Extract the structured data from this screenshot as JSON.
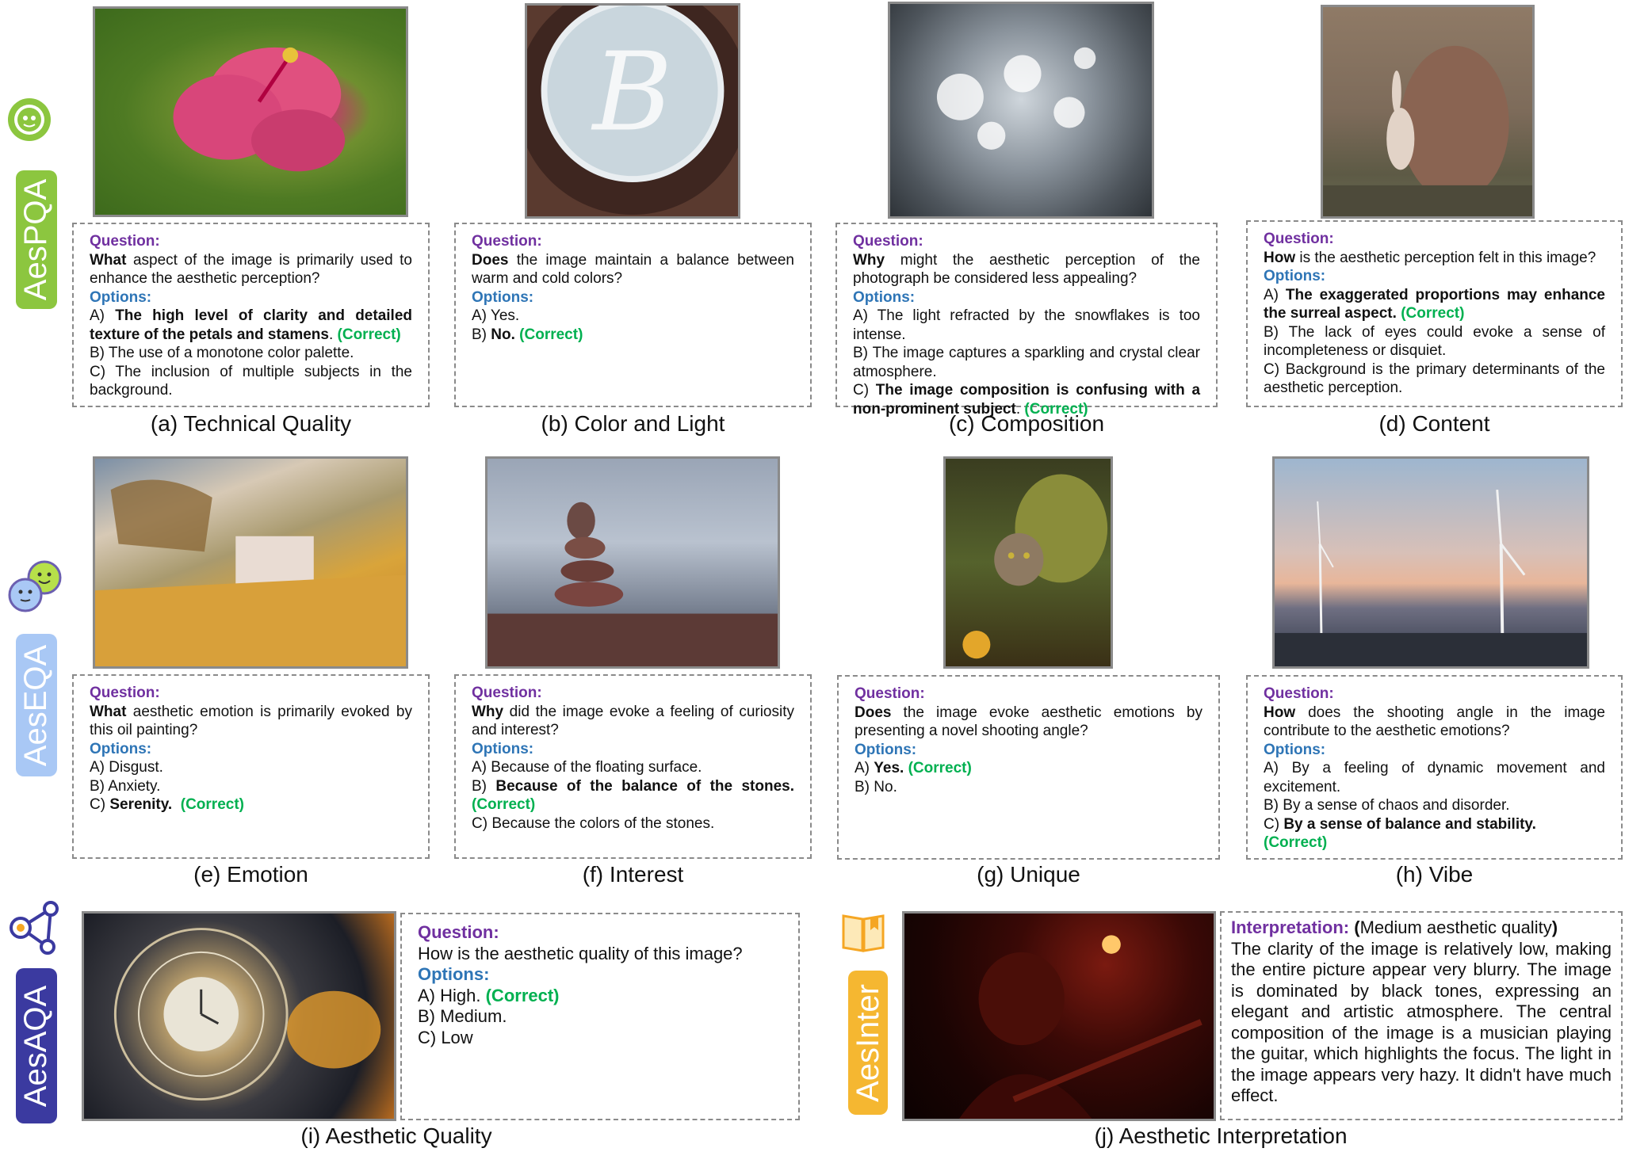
{
  "sections": {
    "aespqa": "AesPQA",
    "aeseqa": "AesEQA",
    "aesaqa": "AesAQA",
    "aesinter": "AesInter"
  },
  "labels": {
    "question": "Question:",
    "options": "Options:",
    "correct": "(Correct)",
    "interpretation": "Interpretation:"
  },
  "panels": {
    "a": {
      "caption": "(a) Technical Quality",
      "q_bold": "What",
      "q_rest": " aspect of the image is primarily used to enhance the aesthetic perception?",
      "opt_a_prefix": "A) ",
      "opt_a_bold": "The high level of clarity and detailed texture of the petals and stamens",
      "opt_a_tail": ". ",
      "opt_b": "B) The use of a monotone color palette.",
      "opt_c": "C) The inclusion of multiple subjects in the background."
    },
    "b": {
      "caption": "(b) Color and Light",
      "q_bold": "Does",
      "q_rest": " the image maintain a balance between warm and cold colors?",
      "opt_a": "A) Yes.",
      "opt_b_prefix": "B) ",
      "opt_b_bold": "No."
    },
    "c": {
      "caption": "(c) Composition",
      "q_bold": "Why",
      "q_rest": " might the aesthetic perception of the photograph be considered less appealing?",
      "opt_a": "A) The light refracted by the snowflakes is too intense.",
      "opt_b": "B) The image captures a sparkling and crystal clear atmosphere.",
      "opt_c_prefix": "C) ",
      "opt_c_bold": "The image composition is confusing with a non-prominent subject",
      "opt_c_tail": ". "
    },
    "d": {
      "caption": "(d) Content",
      "q_bold": "How",
      "q_rest": " is the aesthetic perception felt in this image?",
      "opt_a_prefix": "A) ",
      "opt_a_bold": "The exaggerated proportions may enhance the surreal aspect.",
      "opt_b": "B) The lack of eyes could evoke a sense of incompleteness or disquiet.",
      "opt_c": "C) Background is the primary determinants of the aesthetic perception."
    },
    "e": {
      "caption": "(e) Emotion",
      "q_bold": "What",
      "q_rest": " aesthetic emotion is primarily evoked by this oil painting?",
      "opt_a": "A) Disgust.",
      "opt_b": "B) Anxiety.",
      "opt_c_prefix": "C) ",
      "opt_c_bold": "Serenity."
    },
    "f": {
      "caption": "(f) Interest",
      "q_bold": "Why",
      "q_rest": " did the image evoke a feeling of curiosity and interest?",
      "opt_a": "A) Because of the floating surface.",
      "opt_b_prefix": "B) ",
      "opt_b_bold": "Because of the balance of the stones.",
      "opt_c": "C) Because the colors of the stones."
    },
    "g": {
      "caption": "(g) Unique",
      "q_bold": "Does",
      "q_rest": " the image evoke aesthetic emotions by presenting a novel shooting angle?",
      "opt_a_prefix": "A) ",
      "opt_a_bold": "Yes.",
      "opt_b": "B) No."
    },
    "h": {
      "caption": "(h) Vibe",
      "q_bold": "How",
      "q_rest": " does the shooting angle in the image contribute to the aesthetic emotions?",
      "opt_a": "A) By a feeling of dynamic movement and excitement.",
      "opt_b": "B) By a sense of chaos and disorder.",
      "opt_c_prefix": "C) ",
      "opt_c_bold": "By a sense of balance and stability."
    },
    "i": {
      "caption": "(i) Aesthetic Quality",
      "question": "How is the aesthetic quality of this image?",
      "opt_a": "A) High.",
      "opt_b": "B) Medium.",
      "opt_c": "C) Low"
    },
    "j": {
      "caption": "(j) Aesthetic Interpretation",
      "paren_open": "(",
      "quality": "Medium aesthetic quality",
      "paren_close": ")",
      "text": "The clarity of the image is relatively low, making the entire picture appear very blurry. The image is dominated by black tones, expressing an elegant and artistic atmosphere. The central composition of the image is a musician playing the guitar, which highlights the focus. The light in the image appears very hazy. It didn't have much effect."
    }
  },
  "colors": {
    "question": "#7030a0",
    "options": "#2e75b6",
    "correct": "#00b050",
    "aespqa": "#8cc63f",
    "aeseqa": "#a9c8f5",
    "aesaqa": "#3b3aa0",
    "aesinter": "#f5b731"
  },
  "icons": [
    "robot-icon",
    "emoji-faces-icon",
    "network-nodes-icon",
    "book-icon"
  ]
}
